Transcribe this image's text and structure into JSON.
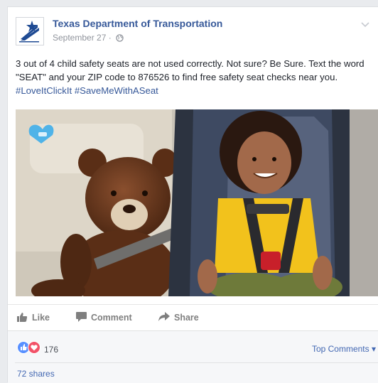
{
  "post": {
    "page_name": "Texas Department of Transportation",
    "date": "September 27",
    "separator": "·",
    "text": "3 out of 4 child safety seats are not used correctly. Not sure? Be Sure. Text the word \"SEAT\" and your ZIP code to 876526 to find free safety seat checks near you.",
    "hashtags": "#LoveItClickIt #SaveMeWithASeat"
  },
  "actions": {
    "like": "Like",
    "comment": "Comment",
    "share": "Share"
  },
  "reactions": {
    "count": "176",
    "top_comments": "Top Comments ▾",
    "shares": "72 shares"
  },
  "icons": {
    "logo": "txdot-logo",
    "globe": "globe-icon",
    "menu": "chevron-down-icon",
    "like": "thumbs-up-icon",
    "comment": "comment-bubble-icon",
    "share": "share-arrow-icon",
    "reaction_like": "like-reaction-icon",
    "reaction_love": "love-reaction-icon"
  },
  "colors": {
    "link": "#365899",
    "like_blue": "#5890ff",
    "love_red": "#f25268",
    "heart_logo": "#4fb3e8"
  }
}
